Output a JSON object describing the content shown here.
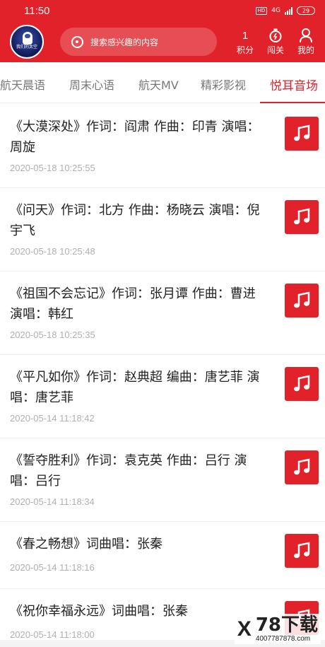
{
  "status_bar": {
    "time": "11:50",
    "network": "4G",
    "hd": "HD",
    "battery": "29"
  },
  "header": {
    "avatar_caption": "我们的太空",
    "search_placeholder": "搜索感兴趣的内容",
    "points_value": "1",
    "points_label": "积分",
    "challenge_label": "闯关",
    "mine_label": "我的"
  },
  "tabs": [
    "航天晨语",
    "周末心语",
    "航天MV",
    "精彩影视",
    "悦耳音场"
  ],
  "active_tab": "悦耳音场",
  "items": [
    {
      "title": "《大漠深处》作词：阎肃 作曲：印青 演唱：周旋",
      "date": "2020-05-18 10:25:55"
    },
    {
      "title": "《问天》作词：北方 作曲：杨晓云 演唱：倪宇飞",
      "date": "2020-05-18 10:25:48"
    },
    {
      "title": "《祖国不会忘记》作词：张月谭 作曲：曹进 演唱：韩红",
      "date": "2020-05-18 10:25:35"
    },
    {
      "title": "《平凡如你》作词：赵典超 编曲：唐艺菲 演唱：唐艺菲",
      "date": "2020-05-14 11:18:42"
    },
    {
      "title": "《誓夺胜利》作词：袁克英 作曲：吕行 演唱：吕行",
      "date": "2020-05-14 11:18:34"
    },
    {
      "title": "《春之畅想》词曲唱：张秦",
      "date": "2020-05-14 11:18:16"
    },
    {
      "title": "《祝你幸福永远》词曲唱：张秦",
      "date": "2020-05-14 11:18:00"
    }
  ],
  "watermark": {
    "logo": "78下载",
    "url": "4007787878.com"
  },
  "colors": {
    "brand_red": "#e1222a",
    "date_gray": "#b0b0b0"
  }
}
